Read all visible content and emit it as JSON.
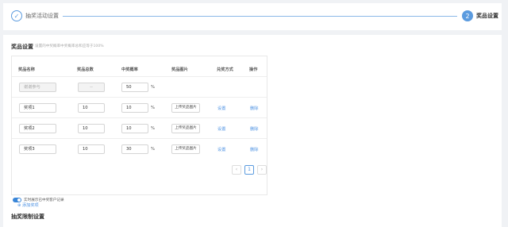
{
  "steps": [
    {
      "label": "抽奖活动设置",
      "icon": "check-icon",
      "status": "done"
    },
    {
      "label": "奖品设置",
      "number": "2",
      "status": "active"
    }
  ],
  "prizes_section": {
    "title": "奖品设置",
    "description": "设置的中奖概率中奖概率总和应等于100%",
    "columns": [
      "奖品名称",
      "奖品总数",
      "中奖概率",
      "奖品图片",
      "兑奖方式",
      "操作"
    ],
    "default_row": {
      "name_placeholder": "谢谢参与",
      "total": "--",
      "probability": "50",
      "percent": "%"
    },
    "rows": [
      {
        "name": "奖项1",
        "total": "10",
        "probability": "10",
        "percent": "%",
        "upload": "上传奖品图片",
        "setting": "设置",
        "delete": "删除"
      },
      {
        "name": "奖项2",
        "total": "10",
        "probability": "10",
        "percent": "%",
        "upload": "上传奖品图片",
        "setting": "设置",
        "delete": "删除"
      },
      {
        "name": "奖项3",
        "total": "10",
        "probability": "30",
        "percent": "%",
        "upload": "上传奖品图片",
        "setting": "设置",
        "delete": "删除"
      }
    ],
    "pagination": {
      "prev": "‹",
      "current": "1",
      "next": "›"
    },
    "add_label": "⊕ 添加奖项"
  },
  "toggle": {
    "label": "实时展示已中奖客户记录",
    "on": true,
    "color": "#3a86d8"
  },
  "limit_section": {
    "title": "抽奖限制设置"
  },
  "colors": {
    "accent": "#4a90e2",
    "step_line": "#8bb8e8"
  }
}
